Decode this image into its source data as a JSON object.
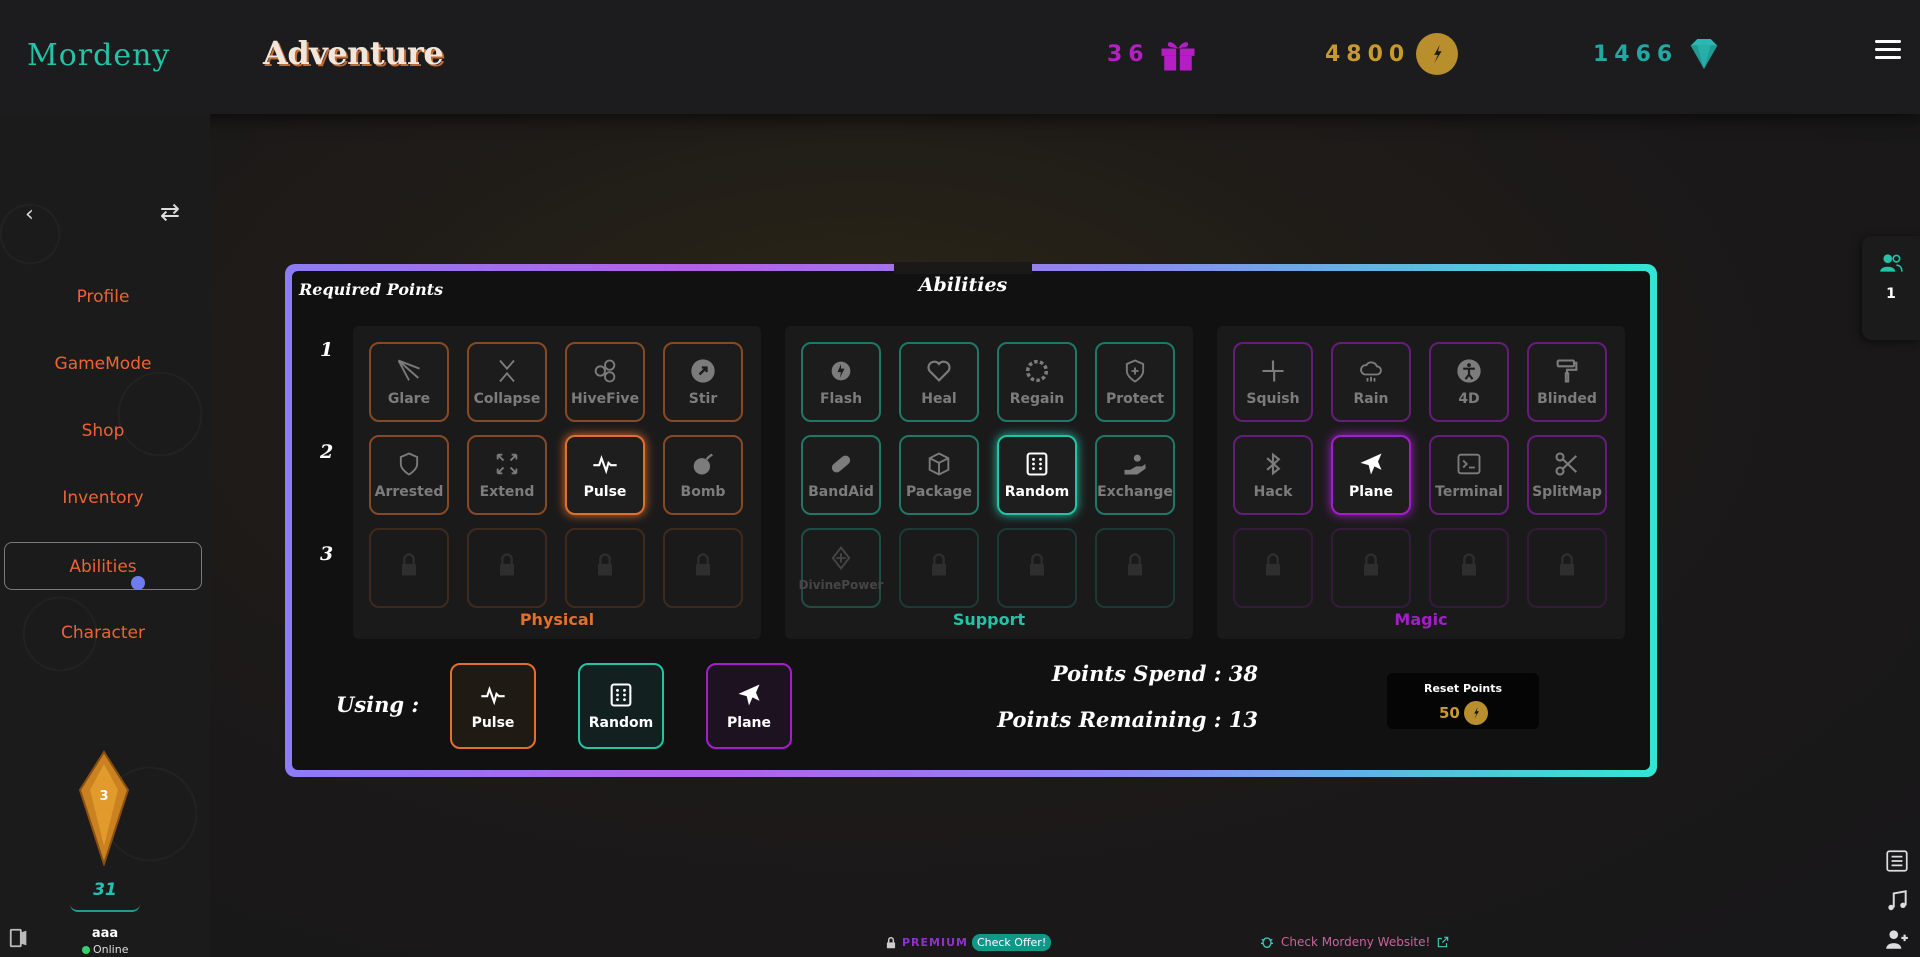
{
  "header": {
    "brand": "Mordeny",
    "title": "Adventure",
    "gifts": "36",
    "coins": "4800",
    "gems": "1466"
  },
  "sidebar": {
    "items": [
      "Profile",
      "GameMode",
      "Shop",
      "Inventory",
      "Abilities",
      "Character"
    ],
    "active": "Abilities",
    "level": "3",
    "count": "31",
    "username": "aaa",
    "status": "Online"
  },
  "panel": {
    "title": "Abilities",
    "required_label": "Required Points",
    "rows": [
      "1",
      "2",
      "3"
    ],
    "groups": [
      {
        "name": "Physical",
        "color": "#e0702a",
        "abilities": [
          [
            "Glare",
            "Collapse",
            "HiveFive",
            "Stir"
          ],
          [
            "Arrested",
            "Extend",
            "Pulse",
            "Bomb"
          ],
          [
            "",
            "",
            "",
            ""
          ]
        ]
      },
      {
        "name": "Support",
        "color": "#22c3a6",
        "abilities": [
          [
            "Flash",
            "Heal",
            "Regain",
            "Protect"
          ],
          [
            "BandAid",
            "Package",
            "Random",
            "Exchange"
          ],
          [
            "DivinePower",
            "",
            "",
            ""
          ]
        ]
      },
      {
        "name": "Magic",
        "color": "#a31ec8",
        "abilities": [
          [
            "Squish",
            "Rain",
            "4D",
            "Blinded"
          ],
          [
            "Hack",
            "Plane",
            "Terminal",
            "SplitMap"
          ],
          [
            "",
            "",
            "",
            ""
          ]
        ]
      }
    ],
    "selected": [
      "Pulse",
      "Random",
      "Plane"
    ],
    "using_label": "Using :",
    "using": [
      "Pulse",
      "Random",
      "Plane"
    ],
    "points_spend": "Points Spend : 38",
    "points_remaining": "Points Remaining : 13",
    "reset_label": "Reset Points",
    "reset_cost": "50"
  },
  "right_panel": {
    "online_count": "1"
  },
  "footer": {
    "premium": "PREMIUM",
    "offer": "Check Offer!",
    "website": "Check Mordeny Website!"
  },
  "colors": {
    "physical": "#e0702a",
    "support": "#22c3a6",
    "magic": "#a31ec8",
    "accent_coin": "#c79a2b"
  }
}
